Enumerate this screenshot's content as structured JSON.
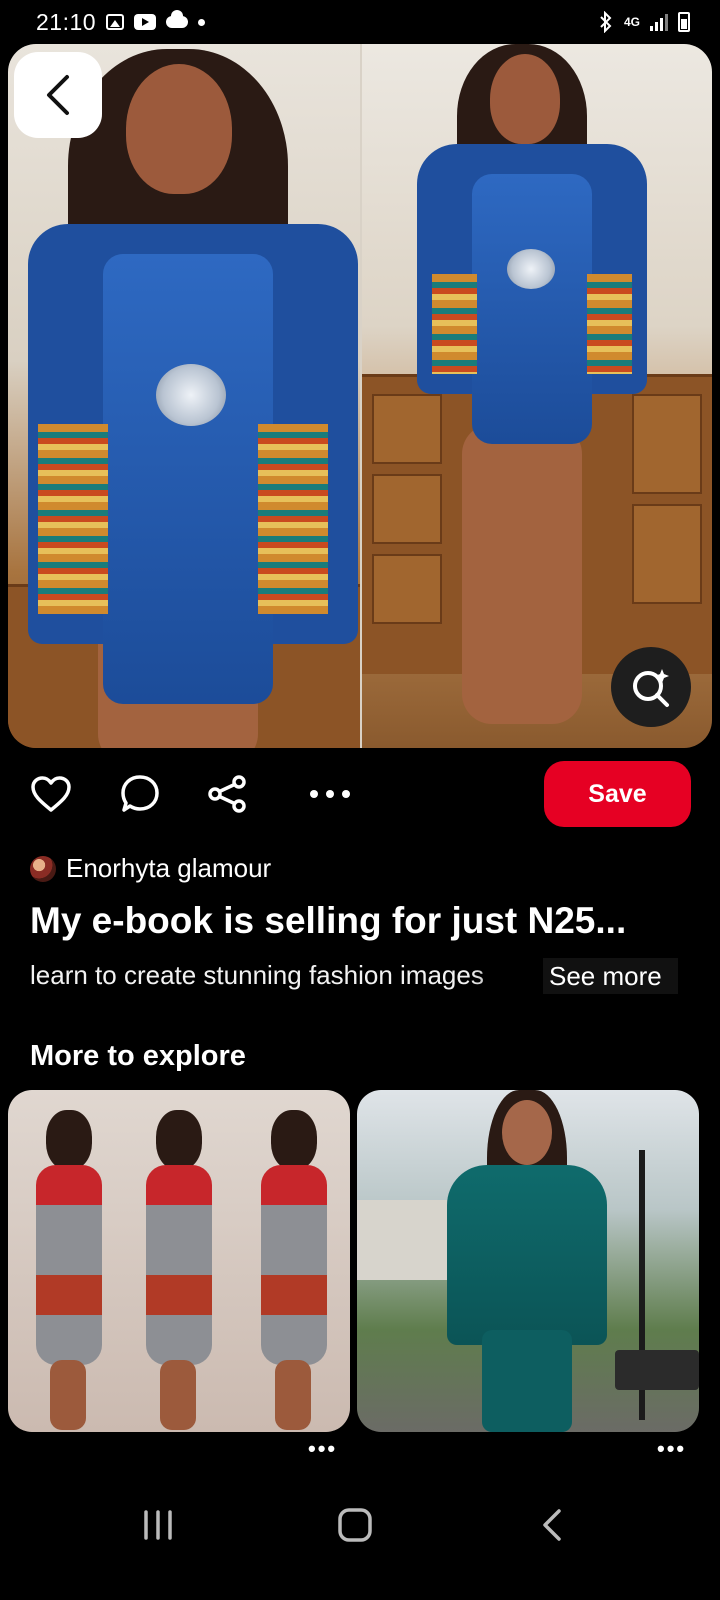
{
  "status_bar": {
    "time": "21:10",
    "network": "4G",
    "notification_icons": [
      "gallery-icon",
      "youtube-icon",
      "cloud-icon",
      "dot-icon"
    ],
    "system_icons": [
      "bluetooth-icon",
      "signal-icon",
      "battery-icon"
    ]
  },
  "pin": {
    "author": "Enorhyta glamour",
    "title": "My e-book is selling for just N25...",
    "description": "learn to create stunning fashion images",
    "see_more": "See more"
  },
  "actions": {
    "save_label": "Save",
    "icons": [
      "heart-icon",
      "comment-icon",
      "share-icon",
      "more-icon"
    ]
  },
  "more_to_explore": {
    "title": "More to explore",
    "items": [
      {
        "name": "explore-pin-1"
      },
      {
        "name": "explore-pin-2"
      }
    ]
  },
  "colors": {
    "save_button": "#e60023",
    "background": "#000000",
    "text": "#ffffff"
  },
  "nav_bar": {
    "items": [
      "recent-apps-icon",
      "home-icon",
      "back-icon"
    ]
  }
}
